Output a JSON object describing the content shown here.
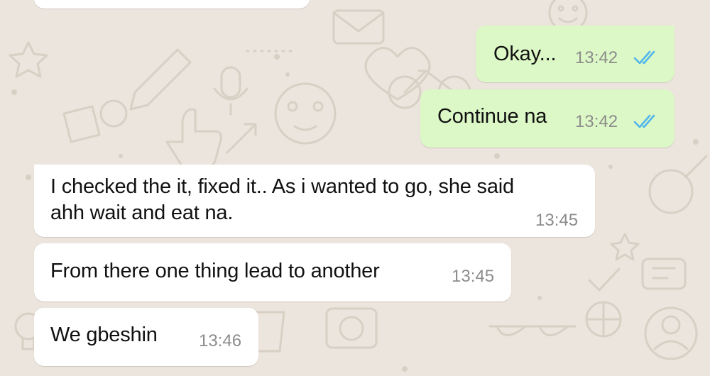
{
  "colors": {
    "wallpaper": "#ece5dd",
    "outgoing_bubble": "#dcf8c6",
    "incoming_bubble": "#ffffff",
    "read_ticks": "#4fb6ec",
    "timestamp": "#8c8c8c"
  },
  "messages": [
    {
      "direction": "outgoing",
      "text": "Okay...",
      "time": "13:42",
      "status": "read"
    },
    {
      "direction": "outgoing",
      "text": "Continue na",
      "time": "13:42",
      "status": "read"
    },
    {
      "direction": "incoming",
      "text_line1": "I checked the it, fixed it.. As i wanted to go, she said",
      "text_line2": "ahh wait and eat na.",
      "time": "13:45"
    },
    {
      "direction": "incoming",
      "text": "From there one thing lead to another",
      "time": "13:45"
    },
    {
      "direction": "incoming",
      "text": "We gbeshin",
      "time": "13:46"
    }
  ]
}
